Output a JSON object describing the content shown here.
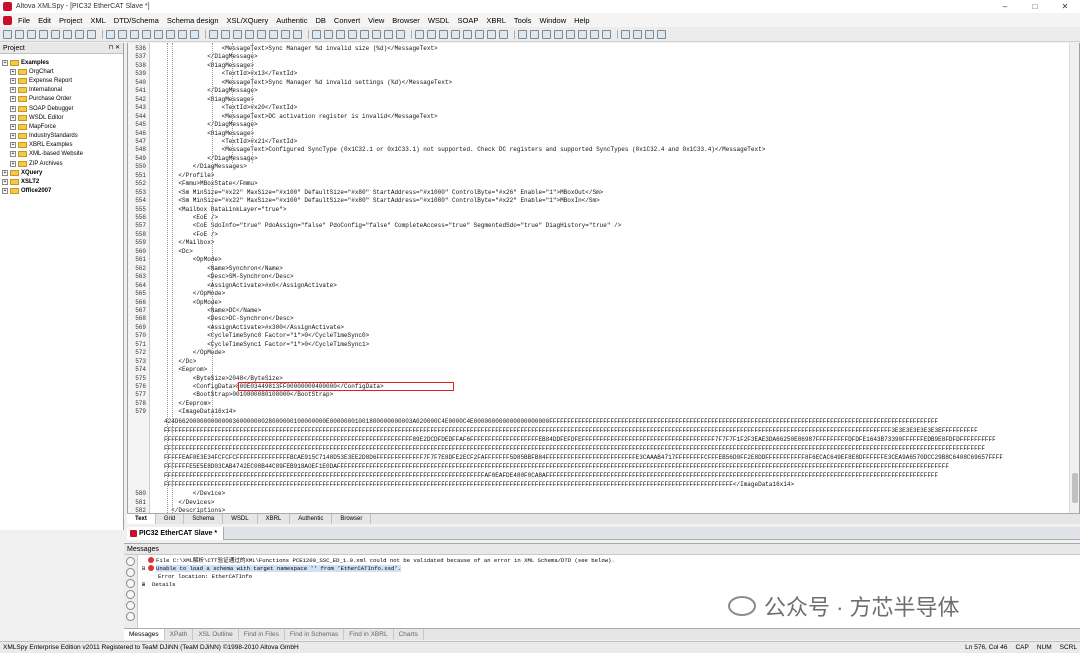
{
  "window": {
    "title": "Altova XMLSpy - [PIC32 EtherCAT Slave *]",
    "controls": [
      "–",
      "□",
      "✕"
    ]
  },
  "menu": [
    "File",
    "Edit",
    "Project",
    "XML",
    "DTD/Schema",
    "Schema design",
    "XSL/XQuery",
    "Authentic",
    "DB",
    "Convert",
    "View",
    "Browser",
    "WSDL",
    "SOAP",
    "XBRL",
    "Tools",
    "Window",
    "Help"
  ],
  "project": {
    "title": "Project",
    "controls": "⊓ ✕",
    "items": [
      {
        "label": "Examples",
        "bold": true,
        "level": 0
      },
      {
        "label": "OrgChart",
        "level": 1
      },
      {
        "label": "Expense Report",
        "level": 1
      },
      {
        "label": "International",
        "level": 1
      },
      {
        "label": "Purchase Order",
        "level": 1
      },
      {
        "label": "SOAP Debugger",
        "level": 1
      },
      {
        "label": "WSDL Editor",
        "level": 1
      },
      {
        "label": "MapForce",
        "level": 1
      },
      {
        "label": "IndustryStandards",
        "level": 1
      },
      {
        "label": "XBRL Examples",
        "level": 1
      },
      {
        "label": "XML-based Website",
        "level": 1
      },
      {
        "label": "ZIP Archives",
        "level": 1
      },
      {
        "label": "XQuery",
        "bold": true,
        "level": 0
      },
      {
        "label": "XSLT2",
        "bold": true,
        "level": 0
      },
      {
        "label": "Office2007",
        "bold": true,
        "level": 0
      }
    ]
  },
  "editor": {
    "lines": [
      {
        "n": "536",
        "t": "                <MessageText>Sync Manager %d invalid size (%d)</MessageText>"
      },
      {
        "n": "537",
        "t": "            </DiagMessage>"
      },
      {
        "n": "538",
        "t": "            <DiagMessage>"
      },
      {
        "n": "539",
        "t": "                <TextId>#x13</TextId>"
      },
      {
        "n": "540",
        "t": "                <MessageText>Sync Manager %d invalid settings (%d)</MessageText>"
      },
      {
        "n": "541",
        "t": "            </DiagMessage>"
      },
      {
        "n": "542",
        "t": "            <DiagMessage>"
      },
      {
        "n": "543",
        "t": "                <TextId>#x20</TextId>"
      },
      {
        "n": "544",
        "t": "                <MessageText>DC activation register is invalid</MessageText>"
      },
      {
        "n": "545",
        "t": "            </DiagMessage>"
      },
      {
        "n": "546",
        "t": "            <DiagMessage>"
      },
      {
        "n": "547",
        "t": "                <TextId>#x21</TextId>"
      },
      {
        "n": "548",
        "t": "                <MessageText>Configured SyncType (0x1C32.1 or 0x1C33.1) not supported. Check DC registers and supported SyncTypes (0x1C32.4 and 0x1C33.4)</MessageText>"
      },
      {
        "n": "549",
        "t": "            </DiagMessage>"
      },
      {
        "n": "550",
        "t": "        </DiagMessages>"
      },
      {
        "n": "551",
        "t": "    </Profile>"
      },
      {
        "n": "552",
        "t": "    <Fmmu>MBoxState</Fmmu>"
      },
      {
        "n": "553",
        "t": "    <Sm MinSize=\"#x22\" MaxSize=\"#x100\" DefaultSize=\"#x80\" StartAddress=\"#x1000\" ControlByte=\"#x26\" Enable=\"1\">MBoxOut</Sm>"
      },
      {
        "n": "554",
        "t": "    <Sm MinSize=\"#x22\" MaxSize=\"#x100\" DefaultSize=\"#x80\" StartAddress=\"#x1080\" ControlByte=\"#x22\" Enable=\"1\">MBoxIn</Sm>"
      },
      {
        "n": "555",
        "t": "    <Mailbox DataLinkLayer=\"true\">"
      },
      {
        "n": "556",
        "t": "        <EoE />"
      },
      {
        "n": "557",
        "t": "        <CoE SdoInfo=\"true\" PdoAssign=\"false\" PdoConfig=\"false\" CompleteAccess=\"true\" SegmentedSdo=\"true\" DiagHistory=\"true\" />"
      },
      {
        "n": "558",
        "t": "        <FoE />"
      },
      {
        "n": "559",
        "t": "    </Mailbox>"
      },
      {
        "n": "560",
        "t": "    <Dc>"
      },
      {
        "n": "561",
        "t": "        <OpMode>"
      },
      {
        "n": "562",
        "t": "            <Name>Synchron</Name>"
      },
      {
        "n": "563",
        "t": "            <Desc>SM-Synchron</Desc>"
      },
      {
        "n": "564",
        "t": "            <AssignActivate>#x0</AssignActivate>"
      },
      {
        "n": "565",
        "t": "        </OpMode>"
      },
      {
        "n": "566",
        "t": "        <OpMode>"
      },
      {
        "n": "567",
        "t": "            <Name>DC</Name>"
      },
      {
        "n": "568",
        "t": "            <Desc>DC-Synchron</Desc>"
      },
      {
        "n": "569",
        "t": "            <AssignActivate>#x300</AssignActivate>"
      },
      {
        "n": "570",
        "t": "            <CycleTimeSync0 Factor=\"1\">0</CycleTimeSync0>"
      },
      {
        "n": "571",
        "t": "            <CycleTimeSync1 Factor=\"1\">0</CycleTimeSync1>"
      },
      {
        "n": "572",
        "t": "        </OpMode>"
      },
      {
        "n": "573",
        "t": "    </Dc>"
      },
      {
        "n": "574",
        "t": "    <Eeprom>"
      },
      {
        "n": "575",
        "t": "        <ByteSize>2048</ByteSize>"
      },
      {
        "n": "576",
        "t": "        <ConfigData>800E03449813FF00000000400000</ConfigData>"
      },
      {
        "n": "577",
        "t": "        <BootStrap>0010800080108000</BootStrap>"
      },
      {
        "n": "578",
        "t": "    </Eeprom>"
      },
      {
        "n": "579",
        "t": "    <ImageData16x14>"
      }
    ],
    "hex_lines": [
      "424D66200000000000036000000028000000100000000E00000001001800000000003A020000C4E0000C4E000000000000000000000FFFFFFFFFFFFFFFFFFFFFFFFFFFFFFFFFFFFFFFFFFFFFFFFFFFFFFFFFFFFFFFFFFFFFFFFFFFFFFFFFFFFFFFFFFFFFFFFFFFFFFFFFFFF",
      "FFFFFFFFFFFFFFFFFFFFFFFFFFFFFFFFFFFFFFFFFFFFFFFFFFFFFFFFFFFFFFFFFFFFFFFFFFFFFFFFFFFFFFFFFFFFFFFFFFFFFFFFFFFFFFFFFFFFFFFFFFFFFFFFFFFFFFFFFFFFFFFFFFFFFFFFFFFFFFFFFFFFFFFFFFFFFFFFFFFFFFFFFFFFFFFFFFFFFFFFFF3E3E3E3E3E3E3EFFFFFFFFFF",
      "FFFFFFFFFFFFFFFFFFFFFFFFFFFFFFFFFFFFFFFFFFFFFFFFFFFFFFFFFFFFFFFFFFFFF89E2DCDFDEDFFAF6FFFFFFFFFFFFFFFFFFFEB84DDFEFDFEFFFFFFFFFFFFFFFFFFFFFFFFFFFFFFFFFFFFF7F7F7F1F2F3EAE3DA66250E86987FFFFFFFFFDFDFE1643B73390FFFFFFEDB9E8FDFDFFFFFFFFFF",
      "FFFFFFFFFFFFFFFFFFFFFFFFFFFFFFFFFFFFFFFFFFFFFFFFFFFFFFFFFFFFFFFFFFFFFFFFFFFFFFFFFFFFFFFFFFFFFFFFFFFFFFFFFFFFFFFFFFFFFFFFFFFFFFFFFFFFFFFFFFFFFFFFFFFFFFFFFFFFFFFFFFFFFFFFFFFFFFFFFFFFFFFFFFFFFFFFFFFFFFFFFFFFFFFFFFFFFFFFFFFFFFFFFFFF",
      "FFFFFEAF0E3E34FCFCFCFFFFFFFFFFFFFFFBCAE915C7148D53E3EE2D8D6FFFFFFFFFFFFF7F7F7E8DFE2ECF2FAFFFFFFF5D85BBFB84FFFFFFFFFFFFFFFFFFFFFFFFFE3CAAAB4717FFFFFFFFCFFFEB56D0FF2E8DDFFFFFFFFFFF8F6ECAC649EF8E8DFFFFFFE3CEA9A6570DCC29B8C6408C69657FFFF",
      "FFFFFFFE5E5E8D03CAB4742EC08B44C89FEB918AOEF1E0DAFFFFFFFFFFFFFFFFFFFFFFFFFFFFFFFFFFFFFFFFFFFFFFFFFFFFFFFFFFFFFFFFFFFFFFFFFFFFFFFFFFFFFFFFFFFFFFFFFFFFFFFFFFFFFFFFFFFFFFFFFFFFFFFFFFFFFFFFFFFFFFFFFFFFFFFFFFFFFFFFFFFFFFFFFF",
      "FFFFFFFFFFFFFFFFFFFFFFFFFFFFFFFFFFFFFFFFFFFFFFFFFFFFFFFFFFFFFFFFFFFFFFFFFFFFFFFFFFFFFFFFFAF0EAFDE480F0CA8AFFFFFFFFFFFFFFFFFFFFFFFFFFFFFFFFFFFFFFFFFFFFFFFFFFFFFFFFFFFFFFFFFFFFFFFFFFFFFFFFFFFFFFFFFFFFFFFFFFFFFFFFFFFFF",
      "FFFFFFFFFFFFFFFFFFFFFFFFFFFFFFFFFFFFFFFFFFFFFFFFFFFFFFFFFFFFFFFFFFFFFFFFFFFFFFFFFFFFFFFFFFFFFFFFFFFFFFFFFFFFFFFFFFFFFFFFFFFFFFFFFFFFFFFFFFFFFFFFFFFFFFFFFFFFFF</ImageData16x14>"
    ],
    "tail_lines": [
      {
        "n": "580",
        "t": "        </Device>"
      },
      {
        "n": "581",
        "t": "    </Devices>"
      },
      {
        "n": "582",
        "t": "  </Descriptions>"
      },
      {
        "n": "583",
        "t": "</EtherCATInfo>"
      }
    ]
  },
  "view_tabs": [
    "Text",
    "Grid",
    "Schema",
    "WSDL",
    "XBRL",
    "Authentic",
    "Browser"
  ],
  "document_tab": "PIC32 EtherCAT Slave *",
  "messages": {
    "title": "Messages",
    "lines": [
      "File C:\\XML解析\\CTT验证通过的XML\\Functions PCE1200_SSC_ED_1.0.xml could not be validated because of an error in XML Schema/DTD (see below).",
      "Unable to load a schema with target namespace '' from 'EtherCATInfo.xsd'.",
      "Error location: EtherCATInfo",
      "Details"
    ],
    "tabs": [
      "Messages",
      "XPath",
      "XSL Outline",
      "Find in Files",
      "Find in Schemas",
      "Find in XBRL",
      "Charts"
    ]
  },
  "status": {
    "left": "XMLSpy Enterprise Edition v2011    Registered to TeaM DJiNN (TeaM DJiNN)    ©1998-2010 Altova GmbH",
    "position": "Ln 576, Col 46",
    "caps": "CAP",
    "num": "NUM",
    "scrl": "SCRL"
  },
  "watermark": "公众号 · 方芯半导体"
}
